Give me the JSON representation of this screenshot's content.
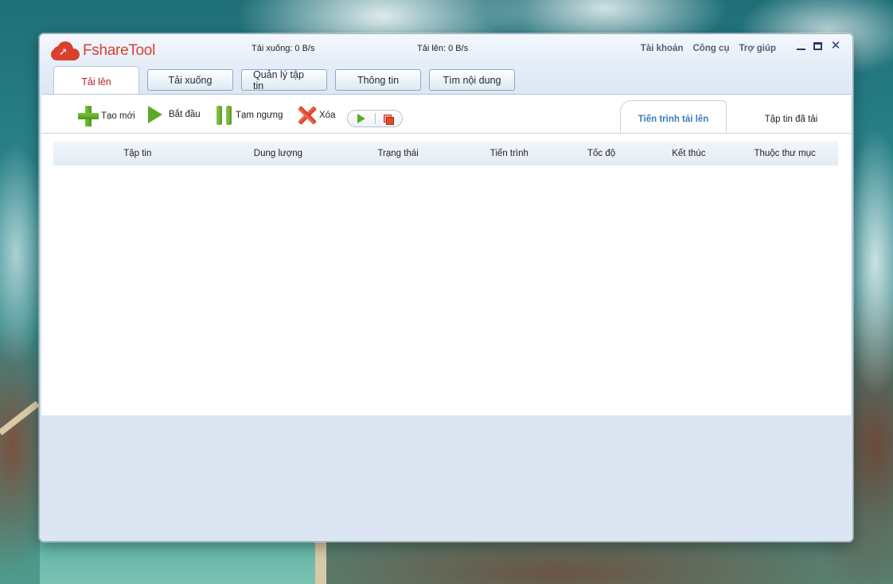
{
  "app": {
    "logo_text": "FshareTool",
    "download_speed": "Tải xuống: 0 B/s",
    "upload_speed": "Tải lên: 0 B/s",
    "brand_color": "#d9412f"
  },
  "top_menu": {
    "account": "Tài khoản",
    "tools": "Công cụ",
    "help": "Trợ giúp"
  },
  "window_controls": {
    "minimize_icon": "minimize-icon",
    "maximize_icon": "maximize-icon",
    "close_icon": "close-icon"
  },
  "main_tabs": [
    {
      "label": "Tải lên",
      "active": true
    },
    {
      "label": "Tải xuống",
      "active": false
    },
    {
      "label": "Quản lý tập tin",
      "active": false
    },
    {
      "label": "Thông tin",
      "active": false
    },
    {
      "label": "Tìm nội dung",
      "active": false
    }
  ],
  "toolbar": {
    "new_label": "Tạo mới",
    "start_label": "Bắt đầu",
    "pause_label": "Tạm ngưng",
    "delete_label": "Xóa"
  },
  "sub_tabs": [
    {
      "label": "Tiến trình tải lên",
      "active": true
    },
    {
      "label": "Tập tin đã tải",
      "active": false
    }
  ],
  "table": {
    "columns": [
      "Tập tin",
      "Dung lượng",
      "Trạng thái",
      "Tiến trình",
      "Tốc độ",
      "Kết thúc",
      "Thuộc thư mục"
    ],
    "rows": []
  }
}
